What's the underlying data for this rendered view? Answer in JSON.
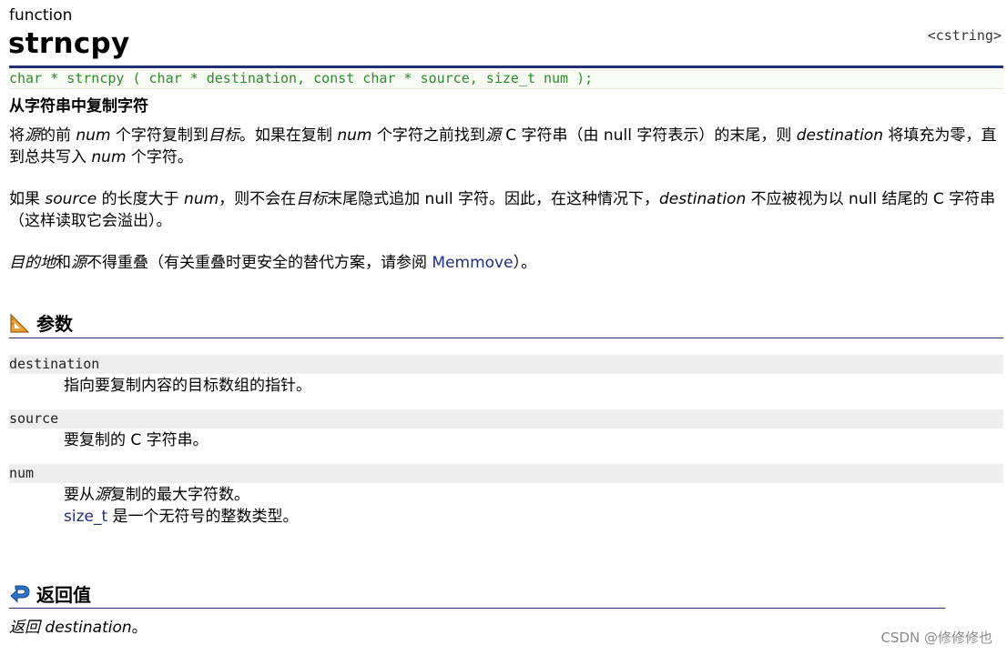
{
  "page": {
    "kind_label": "function",
    "title": "strncpy",
    "header_file": "<cstring>",
    "prototype": "char * strncpy ( char * destination, const char * source, size_t num );",
    "summary": "从字符串中复制字符"
  },
  "description": {
    "p1": {
      "s1": "将",
      "s2": "源",
      "s3": "的前 ",
      "s4": "num",
      "s5": " 个字符复制到",
      "s6": "目标",
      "s7": "。如果在复制 ",
      "s8": "num",
      "s9": " 个字符之前找到",
      "s10": "源",
      "s11": " C 字符串（由 null 字符表示）的末尾，则 ",
      "s12": "destination",
      "s13": " 将填充为零，直到总共写入 ",
      "s14": "num",
      "s15": " 个字符。"
    },
    "p2": {
      "s1": "如果 ",
      "s2": "source",
      "s3": " 的长度大于 ",
      "s4": "num",
      "s5": "，则不会在",
      "s6": "目标",
      "s7": "末尾隐式追加 null 字符。因此，在这种情况下，",
      "s8": "destination",
      "s9": " 不应被视为以 null 结尾的 C 字符串（这样读取它会溢出）。"
    },
    "p3": {
      "s1": "目的地",
      "s2": "和",
      "s3": "源",
      "s4": "不得重叠（有关重叠时更安全的替代方案，请参阅 ",
      "s5": "Memmove",
      "s6": "）。"
    }
  },
  "parameters": {
    "heading": "参数",
    "items": [
      {
        "name": "destination",
        "desc1": "指向要复制内容的目标数组的指针。"
      },
      {
        "name": "source",
        "desc1": "要复制的 C 字符串。"
      },
      {
        "name": "num",
        "desc1_a": "要从",
        "desc1_b": "源",
        "desc1_c": "复制的最大字符数。",
        "desc2_link": "size_t",
        "desc2_rest": " 是一个无符号的整数类型。"
      }
    ]
  },
  "return_value": {
    "heading": "返回值",
    "t1": "返回",
    "t2": " destination",
    "t3": "。"
  },
  "watermark": "CSDN @修修修也",
  "colors": {
    "rule": "#1f2f6f",
    "prototype_text": "#2e8b2e",
    "link": "#1f2f7f",
    "param_bar": "#eeeeee"
  },
  "icons": {
    "parameters": "triangle-ruler-icon",
    "return_value": "return-arrow-icon"
  }
}
